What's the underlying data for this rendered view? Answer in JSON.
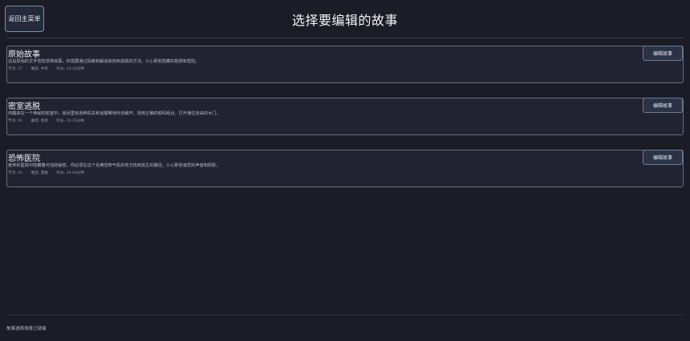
{
  "header": {
    "back_label": "返回主菜单",
    "title": "选择要编辑的故事"
  },
  "stories": [
    {
      "title": "原始故事",
      "description": "这是原始的文字冒险恐怖故事。你需要通过探索和解谜来找到逃脱的方法。小心那些隐藏的陷阱和危险。",
      "nodes": "节点: 27",
      "difficulty": "难度: 中等",
      "duration": "时长: 15-30分钟",
      "edit_label": "编辑故事"
    },
    {
      "title": "密室逃脱",
      "description": "你醒来在一个神秘的密室中，房间里有各种机关和谜题等待你去解开。找到正确的密码组合，打开通往自由的大门。",
      "nodes": "节点: 41",
      "difficulty": "难度: 简单",
      "duration": "时长: 10-20分钟",
      "edit_label": "编辑故事"
    },
    {
      "title": "恐怖医院",
      "description": "废弃的医院中隐藏着可怕的秘密。你必须在这个充满恐怖气氛的地方找到逃生的路径。小心那些诡异的声音和阴影。",
      "nodes": "节点: 41",
      "difficulty": "难度: 困难",
      "duration": "时长: 20-40分钟",
      "edit_label": "编辑故事"
    }
  ],
  "footer": {
    "status": "故事选择场景已就绪"
  }
}
